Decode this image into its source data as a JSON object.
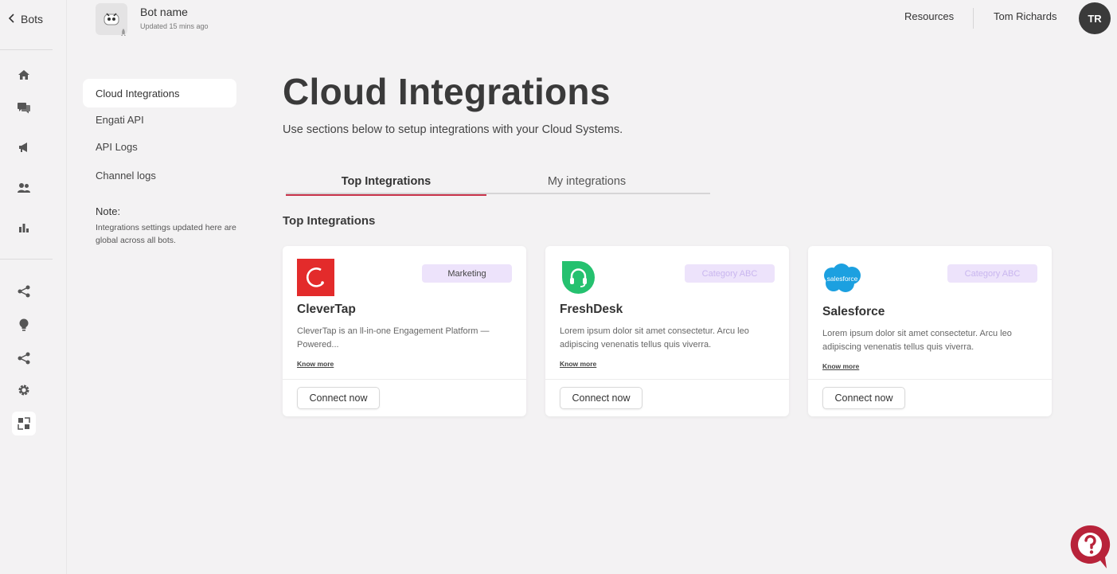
{
  "rail": {
    "back_label": "Bots",
    "icons": [
      "home-icon",
      "chat-icon",
      "megaphone-icon",
      "users-icon",
      "bar-chart-icon",
      "flow-icon",
      "lightbulb-icon",
      "share-icon",
      "settings-icon",
      "integrations-icon"
    ]
  },
  "header": {
    "bot_name": "Bot name",
    "updated": "Updated 15 mins ago",
    "resources": "Resources",
    "user_name": "Tom Richards",
    "user_initials": "TR"
  },
  "subnav": {
    "items": [
      {
        "label": "Cloud Integrations",
        "active": true
      },
      {
        "label": "Engati API"
      },
      {
        "label": "API Logs"
      },
      {
        "label": "Channel logs"
      }
    ],
    "note_title": "Note:",
    "note_text": "Integrations settings updated here are global across all bots."
  },
  "main": {
    "title": "Cloud Integrations",
    "subtitle": "Use sections below to setup integrations with your Cloud Systems.",
    "tabs": [
      {
        "label": "Top Integrations",
        "active": true
      },
      {
        "label": "My integrations"
      }
    ],
    "section_title": "Top Integrations",
    "cards": [
      {
        "name": "CleverTap",
        "category": "Marketing",
        "description": "CleverTap is an ll-in-one Engagement Platform — Powered...",
        "know_more": "Know more",
        "connect": "Connect now",
        "logo_color": "#e32b2b"
      },
      {
        "name": "FreshDesk",
        "category": "Category ABC",
        "description": "Lorem ipsum dolor sit amet consectetur. Arcu leo adipiscing venenatis tellus quis viverra.",
        "know_more": "Know more",
        "connect": "Connect now",
        "logo_color": "#25c16f"
      },
      {
        "name": "Salesforce",
        "category": "Category ABC",
        "description": "Lorem ipsum dolor sit amet consectetur. Arcu leo adipiscing venenatis tellus quis viverra.",
        "know_more": "Know more",
        "connect": "Connect now",
        "logo_color": "#1ca0e0",
        "logo_text": "salesforce"
      }
    ]
  },
  "colors": {
    "accent": "#c8334a",
    "badge_bg": "#ede3fb"
  }
}
